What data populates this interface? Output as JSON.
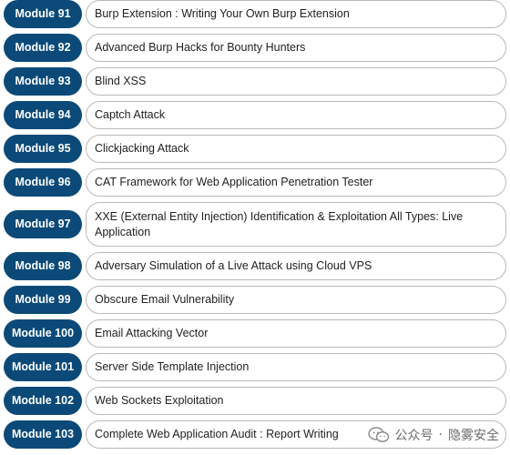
{
  "modules": [
    {
      "badge": "Module 91",
      "title": "Burp Extension : Writing Your Own Burp Extension"
    },
    {
      "badge": "Module 92",
      "title": "Advanced Burp Hacks for Bounty Hunters"
    },
    {
      "badge": "Module 93",
      "title": "Blind XSS"
    },
    {
      "badge": "Module 94",
      "title": "Captch Attack"
    },
    {
      "badge": "Module 95",
      "title": "Clickjacking Attack"
    },
    {
      "badge": "Module 96",
      "title": "CAT Framework for Web Application Penetration Tester"
    },
    {
      "badge": "Module 97",
      "title": "XXE (External Entity Injection) Identification & Exploitation All Types: Live Application"
    },
    {
      "badge": "Module 98",
      "title": "Adversary Simulation of a Live Attack using Cloud VPS"
    },
    {
      "badge": "Module 99",
      "title": "Obscure Email Vulnerability"
    },
    {
      "badge": "Module 100",
      "title": "Email Attacking Vector"
    },
    {
      "badge": "Module 101",
      "title": "Server Side Template Injection"
    },
    {
      "badge": "Module 102",
      "title": "Web Sockets Exploitation"
    },
    {
      "badge": "Module 103",
      "title": "Complete Web Application Audit : Report Writing"
    }
  ],
  "watermark": {
    "source": "公众号",
    "separator": "·",
    "account": "隐雾安全"
  },
  "colors": {
    "badge_bg": "#0b4a78",
    "badge_text": "#ffffff",
    "pill_border": "#b9b9b9",
    "text": "#222222"
  }
}
